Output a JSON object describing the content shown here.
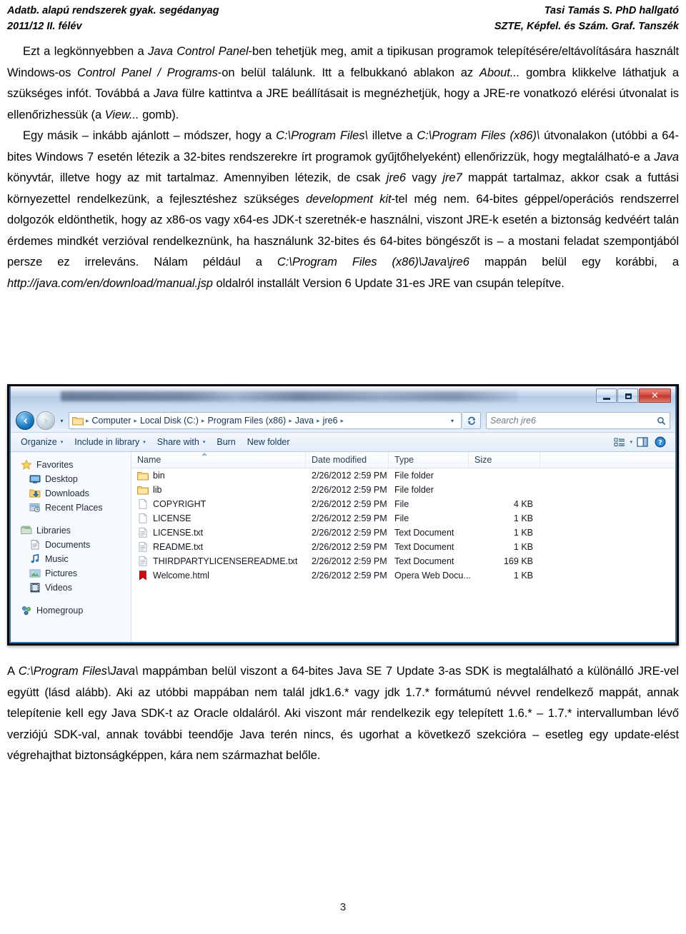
{
  "header": {
    "left_line1": "Adatb. alapú rendszerek gyak. segédanyag",
    "left_line2": "2011/12 II. félév",
    "right_line1": "Tasi Tamás S. PhD hallgató",
    "right_line2": "SZTE, Képfel. és Szám. Graf. Tanszék"
  },
  "body": {
    "para1_a": "Ezt a legkönnyebben a ",
    "para1_i1": "Java Control Panel",
    "para1_b": "-ben tehetjük meg, amit a tipikusan programok telepítésére/eltávolítására használt Windows-os ",
    "para1_i2": "Control Panel / Programs",
    "para1_c": "-on belül találunk. Itt a felbukkanó ablakon az ",
    "para1_i3": "About...",
    "para1_d": " gombra klikkelve láthatjuk a szükséges infót. Továbbá a ",
    "para1_i4": "Java",
    "para1_e": " fülre kattintva a JRE beállításait is megnézhetjük, hogy a JRE-re vonatkozó elérési útvonalat is ellenőrizhessük (a ",
    "para1_i5": "View...",
    "para1_f": " gomb).",
    "para2_a": "Egy másik – inkább ajánlott – módszer, hogy a ",
    "para2_i1": "C:\\Program Files\\",
    "para2_b": " illetve a ",
    "para2_i2": "C:\\Program Files (x86)\\",
    "para2_c": " útvonalakon (utóbbi a 64-bites Windows 7 esetén létezik a 32-bites rendszerekre írt programok gyűjtőhelyeként) ellenőrizzük, hogy megtalálható-e a ",
    "para2_i3": "Java",
    "para2_d": " könyvtár, illetve hogy az mit tartalmaz. Amennyiben létezik, de csak ",
    "para2_i4": "jre6",
    "para2_e": " vagy ",
    "para2_i5": "jre7",
    "para2_f": " mappát tartalmaz, akkor csak a futtási környezettel rendelkezünk, a fejlesztéshez szükséges ",
    "para2_i6": "development kit",
    "para2_g": "-tel még nem. 64-bites géppel/operációs rendszerrel dolgozók eldönthetik, hogy az x86-os vagy x64-es JDK-t szeretnék-e használni, viszont JRE-k esetén a biztonság kedvéért talán érdemes mindkét verzióval rendelkeznünk, ha használunk 32-bites és 64-bites böngészőt is – a mostani feladat szempontjából persze ez irreleváns. Nálam például a ",
    "para2_i7": "C:\\Program Files (x86)\\Java\\jre6",
    "para2_h": " mappán belül egy korábbi, a ",
    "para2_i8": "http://java.com/en/download/manual.jsp",
    "para2_j": " oldalról installált Version 6 Update 31-es JRE van csupán telepítve.",
    "para3_a": "A ",
    "para3_i1": "C:\\Program Files\\Java\\",
    "para3_b": " mappámban belül viszont a 64-bites Java SE 7 Update 3-as SDK is megtalálható a különálló JRE-vel együtt (lásd alább). Aki az utóbbi mappában nem talál jdk1.6.* vagy jdk 1.7.* formátumú névvel rendelkező mappát, annak telepítenie kell egy Java SDK-t az Oracle oldaláról. Aki viszont már rendelkezik egy telepített 1.6.* – 1.7.* intervallumban lévő verziójú SDK-val, annak további teendője Java terén nincs, és ugorhat a következő szekcióra – esetleg egy update-elést végrehajthat biztonságképpen, kára nem származhat belőle."
  },
  "explorer": {
    "window_buttons": {
      "minimize": "–",
      "maximize": "□",
      "close": "✕"
    },
    "nav": {
      "back_icon": "back-arrow-icon",
      "forward_icon": "forward-arrow-icon",
      "history_caret": "▾"
    },
    "breadcrumb": {
      "folder_icon": "folder-icon",
      "items": [
        "Computer",
        "Local Disk (C:)",
        "Program Files (x86)",
        "Java",
        "jre6"
      ],
      "separator": "▸",
      "trailing_caret": "▾",
      "refresh_icon": "refresh-icon"
    },
    "search": {
      "placeholder": "Search jre6",
      "icon": "search-icon"
    },
    "toolbar": {
      "items": [
        {
          "label": "Organize",
          "caret": "▾"
        },
        {
          "label": "Include in library",
          "caret": "▾"
        },
        {
          "label": "Share with",
          "caret": "▾"
        },
        {
          "label": "Burn",
          "caret": ""
        },
        {
          "label": "New folder",
          "caret": ""
        }
      ],
      "view_icon": "view-list-icon",
      "view_caret": "▾",
      "preview_icon": "preview-pane-icon",
      "help_icon": "help-icon"
    },
    "navpane": [
      {
        "label": "Favorites",
        "icon": "star-icon",
        "level": 0
      },
      {
        "label": "Desktop",
        "icon": "desktop-icon",
        "level": 1
      },
      {
        "label": "Downloads",
        "icon": "downloads-icon",
        "level": 1
      },
      {
        "label": "Recent Places",
        "icon": "recent-places-icon",
        "level": 1
      },
      {
        "label": "Libraries",
        "icon": "libraries-icon",
        "level": 0
      },
      {
        "label": "Documents",
        "icon": "documents-icon",
        "level": 1
      },
      {
        "label": "Music",
        "icon": "music-icon",
        "level": 1
      },
      {
        "label": "Pictures",
        "icon": "pictures-icon",
        "level": 1
      },
      {
        "label": "Videos",
        "icon": "videos-icon",
        "level": 1
      },
      {
        "label": "Homegroup",
        "icon": "homegroup-icon",
        "level": 0
      }
    ],
    "columns": [
      "Name",
      "Date modified",
      "Type",
      "Size"
    ],
    "files": [
      {
        "name": "bin",
        "date": "2/26/2012 2:59 PM",
        "type": "File folder",
        "size": "",
        "icon": "folder-icon"
      },
      {
        "name": "lib",
        "date": "2/26/2012 2:59 PM",
        "type": "File folder",
        "size": "",
        "icon": "folder-icon"
      },
      {
        "name": "COPYRIGHT",
        "date": "2/26/2012 2:59 PM",
        "type": "File",
        "size": "4 KB",
        "icon": "blank-file-icon"
      },
      {
        "name": "LICENSE",
        "date": "2/26/2012 2:59 PM",
        "type": "File",
        "size": "1 KB",
        "icon": "blank-file-icon"
      },
      {
        "name": "LICENSE.txt",
        "date": "2/26/2012 2:59 PM",
        "type": "Text Document",
        "size": "1 KB",
        "icon": "text-file-icon"
      },
      {
        "name": "README.txt",
        "date": "2/26/2012 2:59 PM",
        "type": "Text Document",
        "size": "1 KB",
        "icon": "text-file-icon"
      },
      {
        "name": "THIRDPARTYLICENSEREADME.txt",
        "date": "2/26/2012 2:59 PM",
        "type": "Text Document",
        "size": "169 KB",
        "icon": "text-file-icon"
      },
      {
        "name": "Welcome.html",
        "date": "2/26/2012 2:59 PM",
        "type": "Opera Web Docu...",
        "size": "1 KB",
        "icon": "opera-html-icon"
      }
    ]
  },
  "footer": {
    "page_number": "3"
  }
}
